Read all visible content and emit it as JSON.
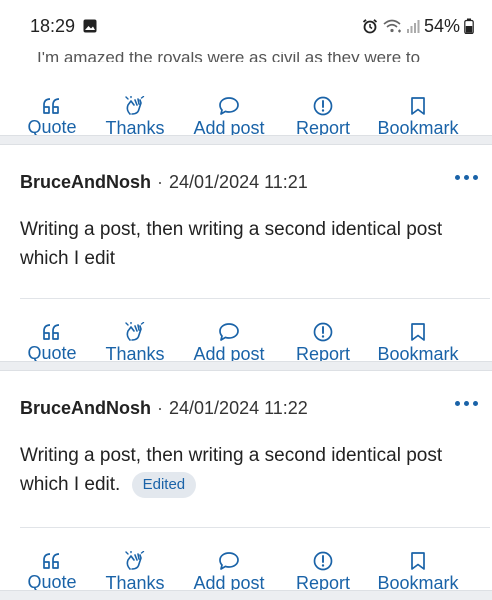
{
  "status_bar": {
    "time": "18:29",
    "battery": "54%"
  },
  "peek_text": "I'm amazed the royals were as civil as they were to",
  "action_labels": {
    "quote": "Quote",
    "thanks": "Thanks",
    "add_post": "Add post",
    "report": "Report",
    "bookmark": "Bookmark"
  },
  "posts": [
    {
      "author": "BruceAndNosh",
      "separator": "·",
      "date": "24/01/2024 11:21",
      "body": "Writing a post, then writing a second identical post which I edit"
    },
    {
      "author": "BruceAndNosh",
      "separator": "·",
      "date": "24/01/2024 11:22",
      "body": "Writing a post, then writing a second identical post which I edit.",
      "badge": "Edited"
    }
  ],
  "colors": {
    "accent": "#1a63a8",
    "separator_band": "#eceef1",
    "badge_bg": "#e3e8ee"
  },
  "icons": [
    "image-icon",
    "alarm-icon",
    "wifi-icon",
    "signal-icon",
    "battery-icon",
    "quote-icon",
    "clapping-hands-icon",
    "speech-bubble-icon",
    "alert-circle-icon",
    "bookmark-icon",
    "more-dots-icon"
  ]
}
